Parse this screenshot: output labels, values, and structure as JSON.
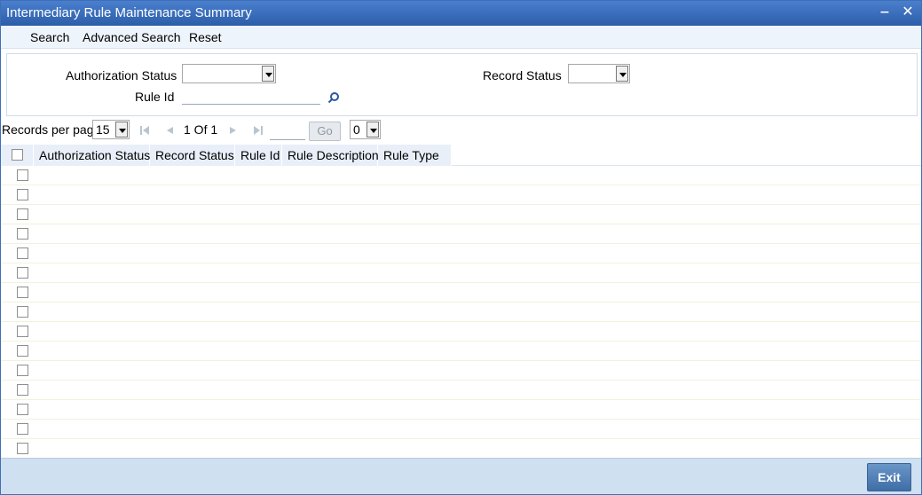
{
  "window": {
    "title": "Intermediary Rule Maintenance Summary",
    "minimize_glyph": "‒",
    "close_glyph": "✕"
  },
  "menu": {
    "items": [
      "Search",
      "Advanced Search",
      "Reset"
    ]
  },
  "criteria": {
    "authorization_status_label": "Authorization Status",
    "authorization_status_value": "",
    "record_status_label": "Record Status",
    "record_status_value": "",
    "rule_id_label": "Rule Id",
    "rule_id_value": ""
  },
  "pager": {
    "records_per_page_label": "Records per page",
    "records_per_page_value": "15",
    "page_info": "1 Of 1",
    "go_label": "Go",
    "jump_value": "0"
  },
  "grid": {
    "columns": [
      "Authorization Status",
      "Record Status",
      "Rule Id",
      "Rule Description",
      "Rule Type"
    ],
    "row_count": 15
  },
  "footer": {
    "exit_label": "Exit"
  },
  "colors": {
    "titlebar": "#2c5ea8",
    "header_bg": "#e8eff8",
    "footer_bg": "#cfe0f1"
  }
}
